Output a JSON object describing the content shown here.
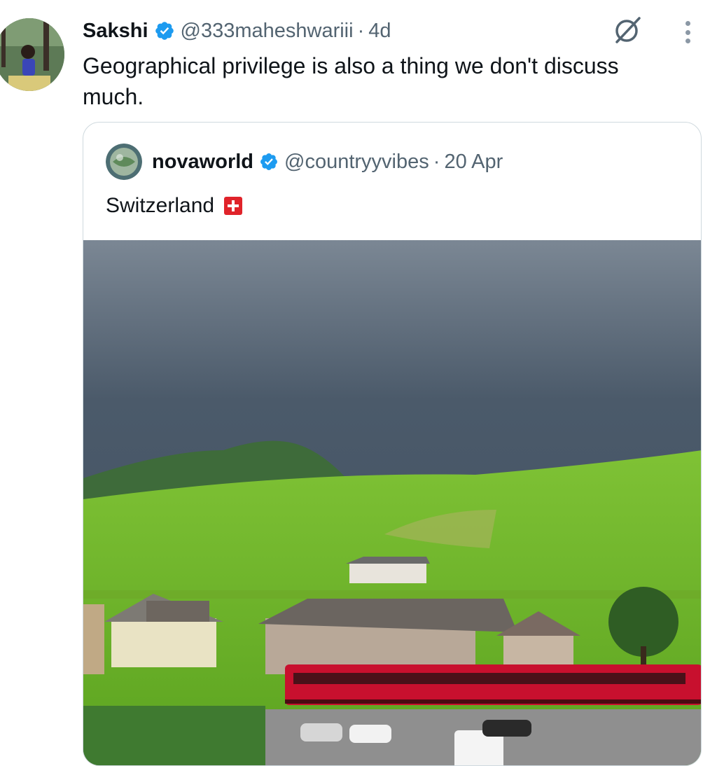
{
  "tweet": {
    "author_name": "Sakshi",
    "handle": "@333maheshwariii",
    "separator": "·",
    "time": "4d",
    "text": "Geographical privilege is also a thing we don't discuss much.",
    "grok_icon": "grok-icon",
    "more_icon": "more-icon"
  },
  "quoted": {
    "author_name": "novaworld",
    "handle": "@countryyvibes",
    "separator": "·",
    "time": "20 Apr",
    "text": "Switzerland",
    "flag_icon": "swiss-flag-icon"
  },
  "colors": {
    "verified": "#1d9bf0",
    "secondary_text": "#536471",
    "border": "#cfd9de",
    "train": "#c8102e"
  }
}
